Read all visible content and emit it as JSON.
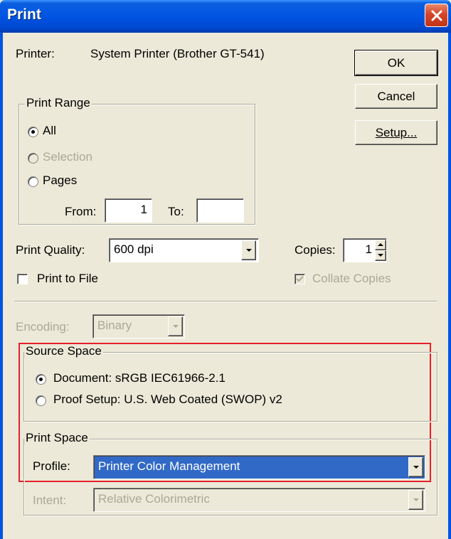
{
  "window": {
    "title": "Print"
  },
  "printer": {
    "label": "Printer:",
    "value": "System Printer (Brother GT-541)"
  },
  "buttons": {
    "ok": "OK",
    "cancel": "Cancel",
    "setup": "Setup..."
  },
  "print_range": {
    "title": "Print Range",
    "all": "All",
    "selection": "Selection",
    "pages": "Pages",
    "from_label": "From:",
    "from_value": "1",
    "to_label": "To:",
    "to_value": "",
    "selected": "All"
  },
  "print_quality": {
    "label": "Print Quality:",
    "value": "600 dpi"
  },
  "copies": {
    "label": "Copies:",
    "value": "1"
  },
  "print_to_file": {
    "label": "Print to File",
    "checked": false
  },
  "collate": {
    "label": "Collate Copies",
    "checked": true,
    "enabled": false
  },
  "encoding": {
    "label": "Encoding:",
    "value": "Binary",
    "enabled": false
  },
  "source_space": {
    "title": "Source Space",
    "document": "Document:  sRGB IEC61966-2.1",
    "proof": "Proof Setup:  U.S. Web Coated (SWOP) v2",
    "selected": "Document"
  },
  "print_space": {
    "title": "Print Space",
    "profile_label": "Profile:",
    "profile_value": "Printer Color Management",
    "intent_label": "Intent:",
    "intent_value": "Relative Colorimetric",
    "intent_enabled": false
  },
  "colors": {
    "highlight_box": "#e8202b",
    "title_bar": "#0054e3",
    "selection": "#3169c6",
    "dialog_bg": "#ece9d8"
  }
}
